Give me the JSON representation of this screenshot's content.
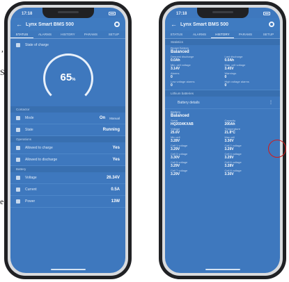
{
  "margin_text": {
    "line1": ",",
    "line2": "S",
    "line3": "e"
  },
  "left_phone": {
    "status_time": "17:18",
    "app_title": "Lynx Smart BMS 500",
    "tabs": [
      "STATUS",
      "ALARMS",
      "HISTORY",
      "PARAMS",
      "SETUP"
    ],
    "active_tab": 0,
    "state_of_charge_label": "State of charge",
    "gauge_value": "65",
    "gauge_unit": "%",
    "sections": [
      {
        "title": "Contactor",
        "rows": [
          {
            "label": "Mode",
            "value": "On",
            "extra": "Manual"
          },
          {
            "label": "State",
            "value": "Running"
          }
        ]
      },
      {
        "title": "Operations",
        "rows": [
          {
            "label": "Allowed to charge",
            "value": "Yes"
          },
          {
            "label": "Allowed to discharge",
            "value": "Yes"
          }
        ]
      },
      {
        "title": "Battery",
        "rows": [
          {
            "label": "Voltage",
            "value": "26.34V"
          },
          {
            "label": "Current",
            "value": "0.5A"
          },
          {
            "label": "Power",
            "value": "13W"
          }
        ]
      }
    ],
    "progress": {
      "state_of_charge_percent": 65
    }
  },
  "right_phone": {
    "status_time": "17:18",
    "app_title": "Lynx Smart BMS 500",
    "tabs": [
      "STATUS",
      "ALARMS",
      "HISTORY",
      "PARAMS",
      "SETUP"
    ],
    "active_tab": 2,
    "history_section": "Statistics",
    "block1": {
      "header": "Reset history",
      "status": "Balanced",
      "cells": [
        {
          "k": "Deepest discharge",
          "v": "0.0Ah"
        },
        {
          "k": "Last discharge",
          "v": "0.0Ah"
        },
        {
          "k": "Min. cell voltage",
          "v": "3.14V"
        },
        {
          "k": "Max. cell voltage",
          "v": "3.45V"
        },
        {
          "k": "Alarms",
          "v": "0"
        },
        {
          "k": "Warnings",
          "v": "0"
        },
        {
          "k": "Low voltage alarms",
          "v": "0"
        },
        {
          "k": "High voltage alarms",
          "v": "0"
        }
      ]
    },
    "expand_section": "Lithium batteries",
    "search_row": "Battery details",
    "more_label": "⋮",
    "block2": {
      "header": "Battery",
      "status": "Balanced",
      "cells": [
        {
          "k": "Serial",
          "v": "HQ2034KXAB"
        },
        {
          "k": "Capacity",
          "v": "200Ah"
        },
        {
          "k": "Voltage",
          "v": "25.6V"
        },
        {
          "k": "Temperature",
          "v": "21.8°C"
        },
        {
          "k": "Min cell",
          "v": "3.28V"
        },
        {
          "k": "Max cell",
          "v": "3.30V"
        },
        {
          "k": "Cell 1 voltage",
          "v": "3.29V"
        },
        {
          "k": "Cell 2 voltage",
          "v": "3.29V"
        },
        {
          "k": "Cell 3 voltage",
          "v": "3.30V"
        },
        {
          "k": "Cell 4 voltage",
          "v": "3.29V"
        },
        {
          "k": "Cell 5 voltage",
          "v": "3.29V"
        },
        {
          "k": "Cell 6 voltage",
          "v": "3.28V"
        },
        {
          "k": "Cell 7 voltage",
          "v": "3.29V"
        },
        {
          "k": "Cell 8 voltage",
          "v": "3.30V"
        }
      ]
    }
  },
  "colors": {
    "screen": "#3e78be",
    "frame": "#202124",
    "highlight_circle": "#d21b1b"
  }
}
